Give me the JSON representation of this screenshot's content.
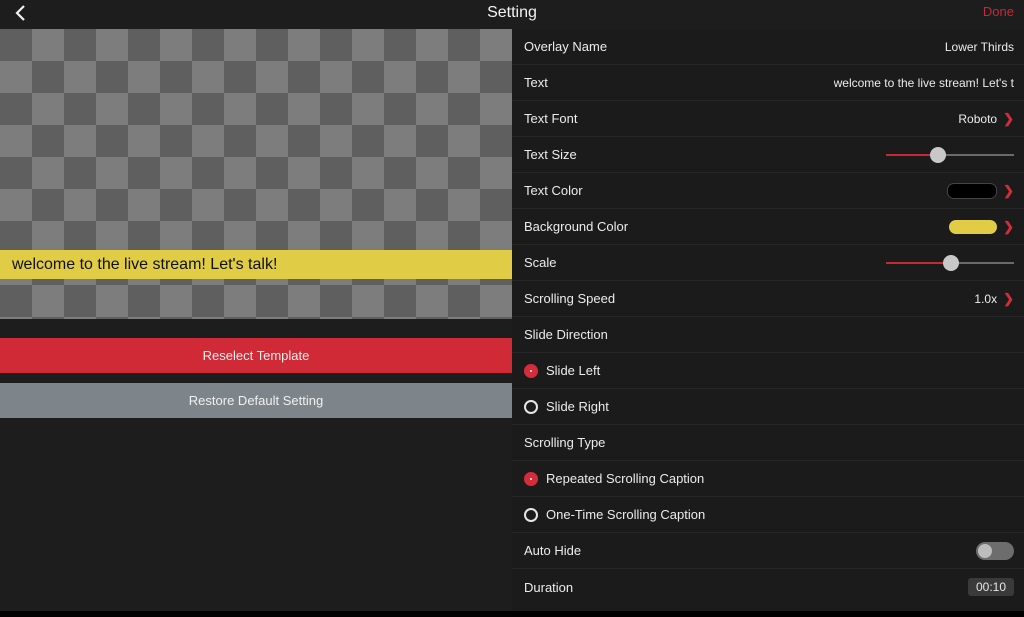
{
  "header": {
    "title": "Setting",
    "done_label": "Done"
  },
  "preview": {
    "caption_text": "welcome to the live stream! Let's talk!"
  },
  "buttons": {
    "reselect_label": "Reselect Template",
    "restore_label": "Restore Default Setting"
  },
  "settings": {
    "overlay_name": {
      "label": "Overlay Name",
      "value": "Lower Thirds"
    },
    "text": {
      "label": "Text",
      "value": "welcome to the live stream! Let's t"
    },
    "text_font": {
      "label": "Text Font",
      "value": "Roboto"
    },
    "text_size": {
      "label": "Text Size",
      "level": 0.41
    },
    "text_color": {
      "label": "Text Color",
      "color": "#000000"
    },
    "background_color": {
      "label": "Background Color",
      "color": "#e0cc45"
    },
    "scale": {
      "label": "Scale",
      "level": 0.51
    },
    "scrolling_speed": {
      "label": "Scrolling Speed",
      "value": "1.0x"
    },
    "slide_direction": {
      "label": "Slide Direction",
      "options": [
        {
          "label": "Slide Left",
          "selected": true
        },
        {
          "label": "Slide Right",
          "selected": false
        }
      ]
    },
    "scrolling_type": {
      "label": "Scrolling Type",
      "options": [
        {
          "label": "Repeated Scrolling Caption",
          "selected": true
        },
        {
          "label": "One-Time Scrolling Caption",
          "selected": false
        }
      ]
    },
    "auto_hide": {
      "label": "Auto Hide",
      "enabled": false
    },
    "duration": {
      "label": "Duration",
      "value": "00:10"
    }
  },
  "colors": {
    "accent": "#d42c3a",
    "caption_bg": "#e0cc45",
    "restore_button": "#7e858a"
  }
}
